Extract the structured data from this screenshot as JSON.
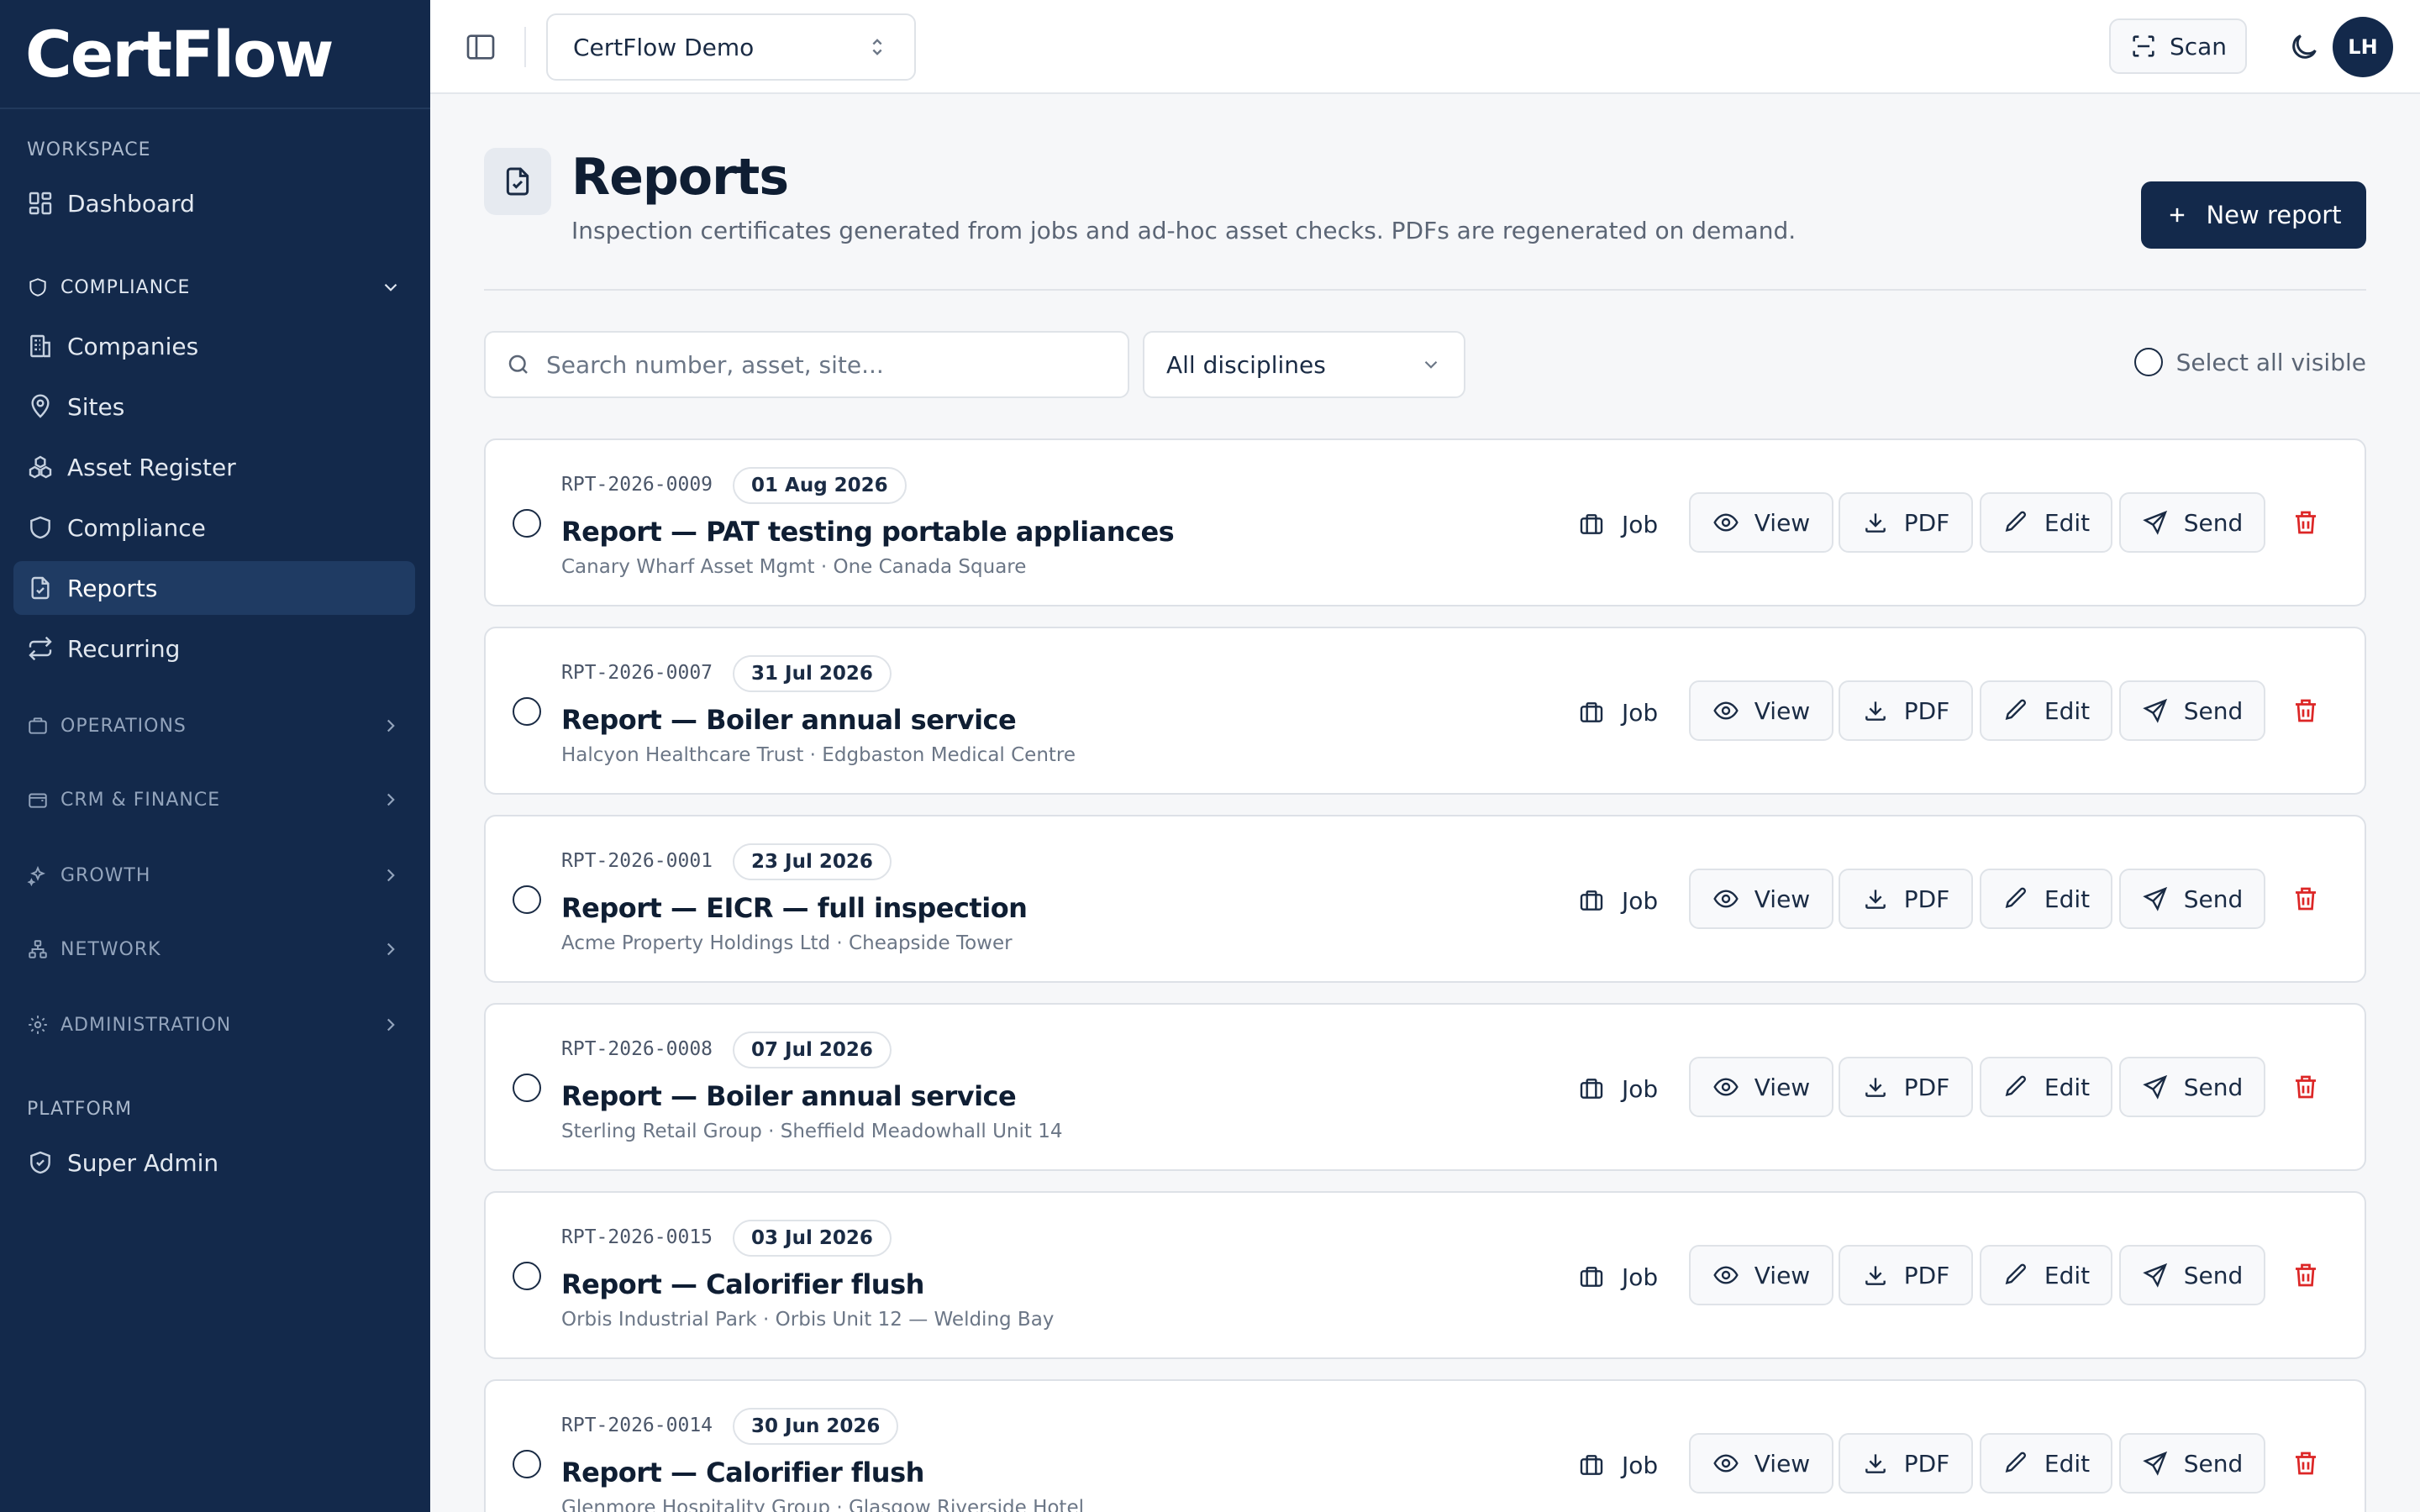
{
  "app": {
    "brand": "CertFlow"
  },
  "sidebar": {
    "workspace_label": "WORKSPACE",
    "dashboard": "Dashboard",
    "compliance_group": "COMPLIANCE",
    "compliance_items": [
      "Companies",
      "Sites",
      "Asset Register",
      "Compliance",
      "Reports",
      "Recurring"
    ],
    "groups": [
      "OPERATIONS",
      "CRM & FINANCE",
      "GROWTH",
      "NETWORK",
      "ADMINISTRATION"
    ],
    "platform_label": "PLATFORM",
    "super_admin": "Super Admin",
    "active_item": "Reports"
  },
  "topbar": {
    "org_name": "CertFlow Demo",
    "scan_label": "Scan",
    "avatar_initials": "LH"
  },
  "header": {
    "title": "Reports",
    "subtitle": "Inspection certificates generated from jobs and ad-hoc asset checks. PDFs are regenerated on demand.",
    "new_button": "New report"
  },
  "filters": {
    "search_placeholder": "Search number, asset, site...",
    "discipline": "All disciplines",
    "select_all": "Select all visible"
  },
  "actions": {
    "job": "Job",
    "view": "View",
    "pdf": "PDF",
    "edit": "Edit",
    "send": "Send"
  },
  "reports": [
    {
      "number": "RPT-2026-0009",
      "date": "01 Aug 2026",
      "title": "Report — PAT testing portable appliances",
      "meta": "Canary Wharf Asset Mgmt · One Canada Square"
    },
    {
      "number": "RPT-2026-0007",
      "date": "31 Jul 2026",
      "title": "Report — Boiler annual service",
      "meta": "Halcyon Healthcare Trust · Edgbaston Medical Centre"
    },
    {
      "number": "RPT-2026-0001",
      "date": "23 Jul 2026",
      "title": "Report — EICR — full inspection",
      "meta": "Acme Property Holdings Ltd · Cheapside Tower"
    },
    {
      "number": "RPT-2026-0008",
      "date": "07 Jul 2026",
      "title": "Report — Boiler annual service",
      "meta": "Sterling Retail Group · Sheffield Meadowhall Unit 14"
    },
    {
      "number": "RPT-2026-0015",
      "date": "03 Jul 2026",
      "title": "Report — Calorifier flush",
      "meta": "Orbis Industrial Park · Orbis Unit 12 — Welding Bay"
    },
    {
      "number": "RPT-2026-0014",
      "date": "30 Jun 2026",
      "title": "Report — Calorifier flush",
      "meta": "Glenmore Hospitality Group · Glasgow Riverside Hotel"
    }
  ]
}
